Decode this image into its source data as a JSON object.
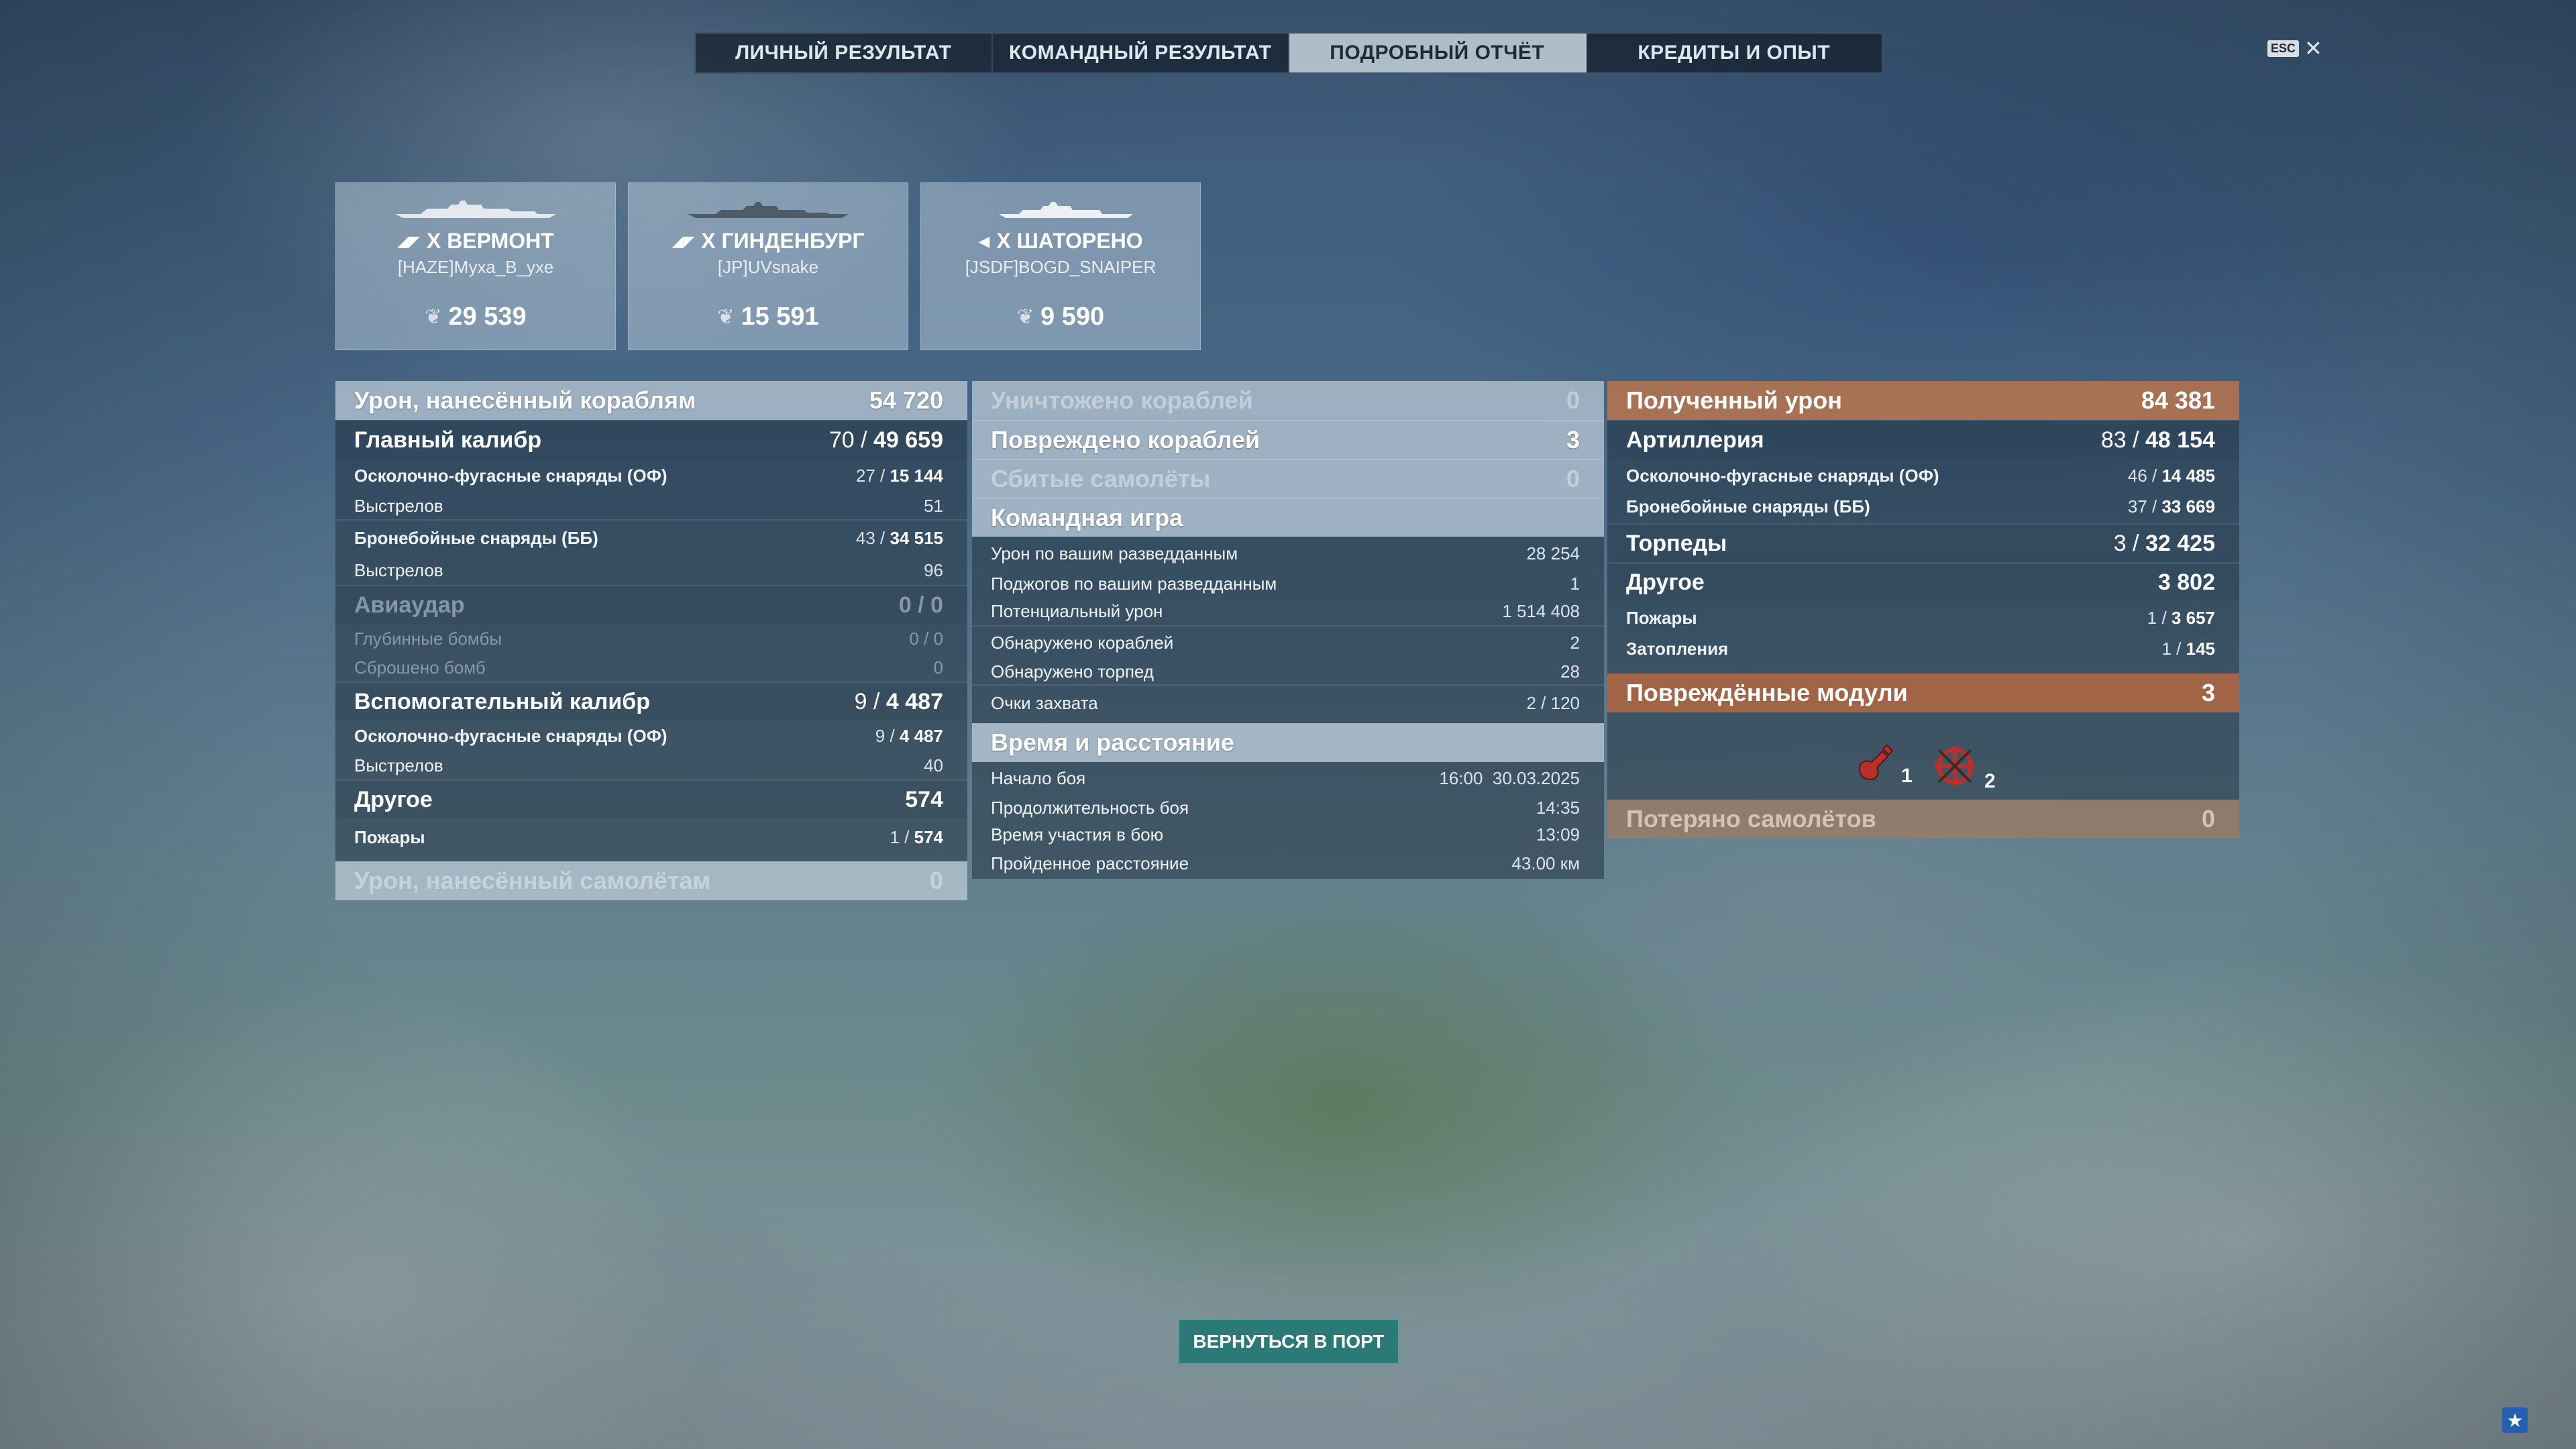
{
  "tabs": [
    {
      "label": "ЛИЧНЫЙ РЕЗУЛЬТАТ",
      "active": false
    },
    {
      "label": "КОМАНДНЫЙ РЕЗУЛЬТАТ",
      "active": false
    },
    {
      "label": "ПОДРОБНЫЙ ОТЧЁТ",
      "active": true
    },
    {
      "label": "КРЕДИТЫ И ОПЫТ",
      "active": false
    }
  ],
  "esc": {
    "key": "ESC",
    "close": "✕"
  },
  "ships": [
    {
      "name": "X ВЕРМОНТ",
      "player": "[HAZE]Муха_В_ухе",
      "score": "29 539",
      "class_icon": "battleship-icon"
    },
    {
      "name": "X ГИНДЕНБУРГ",
      "player": "[JP]UVsnake",
      "score": "15 591",
      "class_icon": "battleship-icon"
    },
    {
      "name": "X ШАТОРЕНО",
      "player": "[JSDF]BOGD_SNAIPER",
      "score": "9 590",
      "class_icon": "cruiser-icon"
    }
  ],
  "left": {
    "damage_ships": {
      "label": "Урон, нанесённый кораблям",
      "value": "54 720"
    },
    "main_battery": {
      "label": "Главный калибр",
      "hits": "70 /",
      "dmg": "49 659"
    },
    "he": {
      "label": "Осколочно-фугасные снаряды (ОФ)",
      "hits": "27 /",
      "dmg": "15 144"
    },
    "he_shots": {
      "label": "Выстрелов",
      "value": "51"
    },
    "ap": {
      "label": "Бронебойные снаряды (ББ)",
      "hits": "43 /",
      "dmg": "34 515"
    },
    "ap_shots": {
      "label": "Выстрелов",
      "value": "96"
    },
    "airstrike": {
      "label": "Авиаудар",
      "value": "0 / 0"
    },
    "depth": {
      "label": "Глубинные бомбы",
      "value": "0 / 0"
    },
    "bombs_dropped": {
      "label": "Сброшено бомб",
      "value": "0"
    },
    "secondary": {
      "label": "Вспомогательный калибр",
      "hits": "9 /",
      "dmg": "4 487"
    },
    "sec_he": {
      "label": "Осколочно-фугасные снаряды (ОФ)",
      "hits": "9 /",
      "dmg": "4 487"
    },
    "sec_shots": {
      "label": "Выстрелов",
      "value": "40"
    },
    "other": {
      "label": "Другое",
      "value": "574"
    },
    "fires": {
      "label": "Пожары",
      "hits": "1 /",
      "dmg": "574"
    },
    "damage_planes": {
      "label": "Урон, нанесённый самолётам",
      "value": "0"
    }
  },
  "middle": {
    "destroyed": {
      "label": "Уничтожено кораблей",
      "value": "0"
    },
    "damaged": {
      "label": "Повреждено кораблей",
      "value": "3"
    },
    "planes_shot": {
      "label": "Сбитые самолёты",
      "value": "0"
    },
    "team_play": {
      "label": "Командная игра"
    },
    "spotting_dmg": {
      "label": "Урон по вашим разведданным",
      "value": "28 254"
    },
    "spotting_fires": {
      "label": "Поджогов по вашим разведданным",
      "value": "1"
    },
    "potential": {
      "label": "Потенциальный урон",
      "value": "1 514 408"
    },
    "ships_spotted": {
      "label": "Обнаружено кораблей",
      "value": "2"
    },
    "torps_spotted": {
      "label": "Обнаружено торпед",
      "value": "28"
    },
    "capture": {
      "label": "Очки захвата",
      "value": "2 / 120"
    },
    "time_distance": {
      "label": "Время и расстояние"
    },
    "battle_start": {
      "label": "Начало боя",
      "value": "16:00  30.03.2025"
    },
    "battle_duration": {
      "label": "Продолжительность боя",
      "value": "14:35"
    },
    "participation": {
      "label": "Время участия в бою",
      "value": "13:09"
    },
    "distance": {
      "label": "Пройденное расстояние",
      "value": "43.00 км"
    }
  },
  "right": {
    "received": {
      "label": "Полученный урон",
      "value": "84 381"
    },
    "artillery": {
      "label": "Артиллерия",
      "hits": "83 /",
      "dmg": "48 154"
    },
    "he": {
      "label": "Осколочно-фугасные снаряды (ОФ)",
      "hits": "46 /",
      "dmg": "14 485"
    },
    "ap": {
      "label": "Бронебойные снаряды (ББ)",
      "hits": "37 /",
      "dmg": "33 669"
    },
    "torpedoes": {
      "label": "Торпеды",
      "hits": "3 /",
      "dmg": "32 425"
    },
    "other": {
      "label": "Другое",
      "value": "3 802"
    },
    "fires": {
      "label": "Пожары",
      "hits": "1 /",
      "dmg": "3 657"
    },
    "flooding": {
      "label": "Затопления",
      "hits": "1 /",
      "dmg": "145"
    },
    "modules": {
      "label": "Повреждённые модули",
      "value": "3"
    },
    "module_items": [
      {
        "icon": "engine-module-icon",
        "count": "1"
      },
      {
        "icon": "steering-module-icon",
        "count": "2"
      }
    ],
    "planes_lost": {
      "label": "Потеряно самолётов",
      "value": "0"
    }
  },
  "footer": {
    "return_port": "ВЕРНУТЬСЯ В ПОРТ"
  }
}
